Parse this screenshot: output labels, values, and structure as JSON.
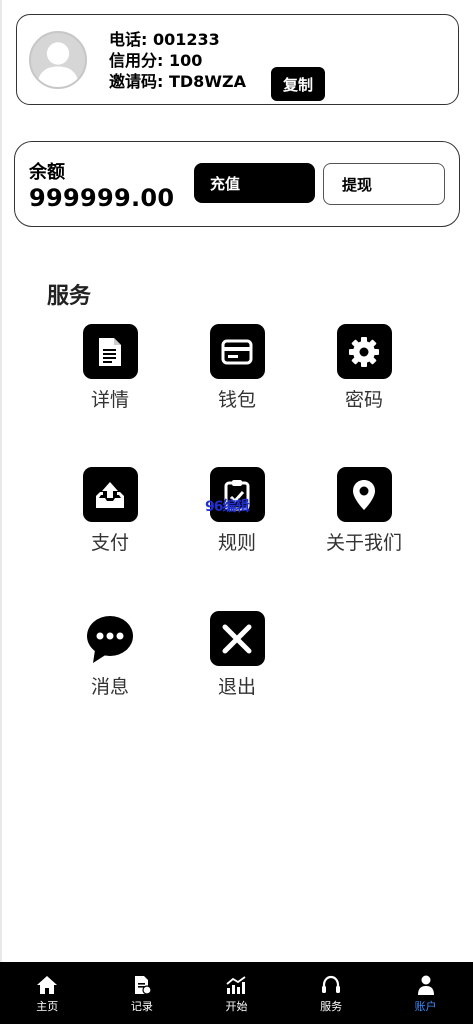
{
  "profile": {
    "phone_label": "电话",
    "phone": "001233",
    "credit_label": "信用分",
    "credit": "100",
    "invite_label": "邀请码",
    "invite_code": "TD8WZA",
    "copy_label": "复制"
  },
  "balance": {
    "label": "余额",
    "value": "999999.00",
    "recharge_label": "充值",
    "withdraw_label": "提现"
  },
  "services": {
    "title": "服务",
    "items": [
      {
        "label": "详情",
        "icon": "document-icon"
      },
      {
        "label": "钱包",
        "icon": "wallet-card-icon"
      },
      {
        "label": "密码",
        "icon": "gear-icon"
      },
      {
        "label": "支付",
        "icon": "inbox-upload-icon"
      },
      {
        "label": "规则",
        "icon": "clipboard-icon"
      },
      {
        "label": "关于我们",
        "icon": "location-pin-icon"
      },
      {
        "label": "消息",
        "icon": "chat-bubble-icon"
      },
      {
        "label": "退出",
        "icon": "close-x-icon"
      }
    ],
    "overlay_text": "96编辑"
  },
  "tabbar": {
    "items": [
      {
        "label": "主页",
        "icon": "home-icon"
      },
      {
        "label": "记录",
        "icon": "record-document-icon"
      },
      {
        "label": "开始",
        "icon": "chart-icon"
      },
      {
        "label": "服务",
        "icon": "headset-icon"
      },
      {
        "label": "账户",
        "icon": "user-icon"
      }
    ],
    "active_index": 4,
    "active_color": "#3d8bfd"
  }
}
